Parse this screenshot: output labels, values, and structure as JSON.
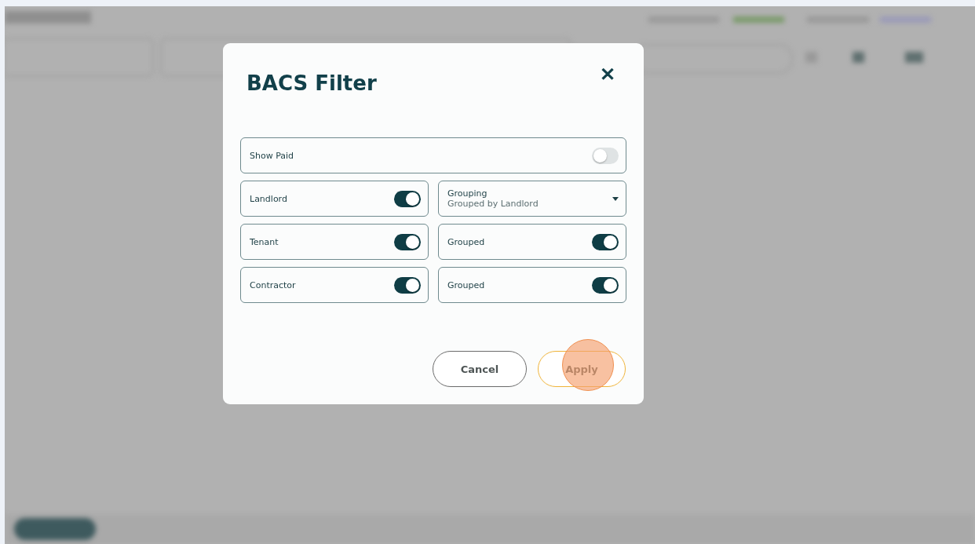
{
  "dialog": {
    "title": "BACS Filter",
    "close": "✕",
    "rows": [
      {
        "cells": [
          {
            "kind": "toggle",
            "label": "Show Paid",
            "on": false
          }
        ]
      },
      {
        "cells": [
          {
            "kind": "toggle",
            "label": "Landlord",
            "on": true
          },
          {
            "kind": "select",
            "label": "Grouping",
            "value": "Grouped by Landlord"
          }
        ]
      },
      {
        "cells": [
          {
            "kind": "toggle",
            "label": "Tenant",
            "on": true
          },
          {
            "kind": "toggle",
            "label": "Grouped",
            "on": true
          }
        ]
      },
      {
        "cells": [
          {
            "kind": "toggle",
            "label": "Contractor",
            "on": true
          },
          {
            "kind": "toggle",
            "label": "Grouped",
            "on": true
          }
        ]
      }
    ],
    "buttons": [
      {
        "label": "Cancel",
        "kind": "secondary",
        "highlighted": false
      },
      {
        "label": "Apply",
        "kind": "primary",
        "highlighted": true
      }
    ]
  }
}
